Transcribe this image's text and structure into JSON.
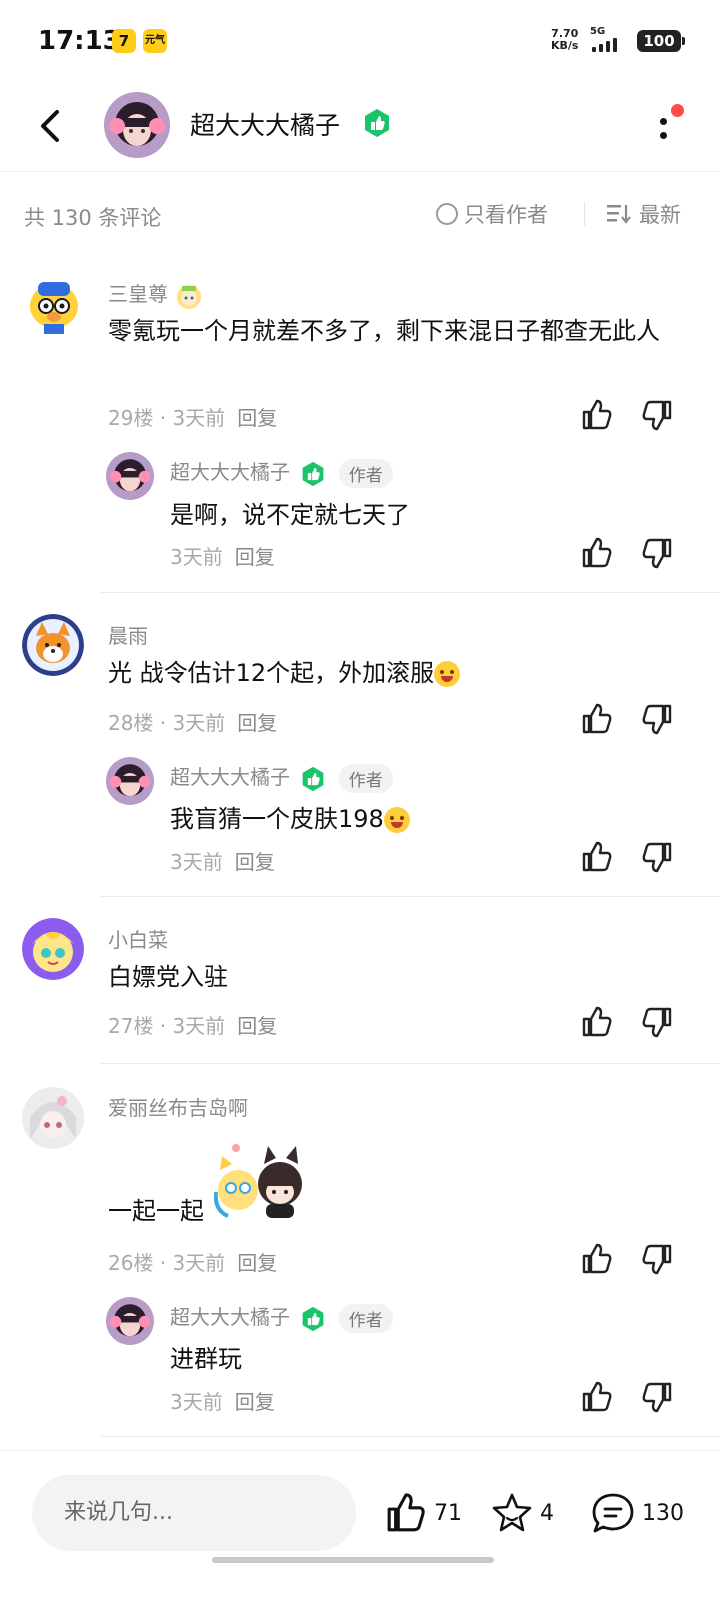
{
  "status_bar": {
    "time": "17:13",
    "app_icon_1": "7",
    "app_icon_2": "元气",
    "net_speed_value": "7.70",
    "net_speed_unit": "KB/s",
    "signal_label": "5G",
    "battery": "100"
  },
  "header": {
    "back_icon": "chevron-left-icon",
    "author_name": "超大大大橘子",
    "badge_icon": "verified-badge-icon",
    "more_icon": "more-vertical-icon",
    "notification_dot_color": "#ff4b4b"
  },
  "filter": {
    "count_label": "共 130 条评论",
    "only_author_label": "只看作者",
    "sort_label": "最新"
  },
  "comments": [
    {
      "user": "三皇尊",
      "text": "零氪玩一个月就差不多了，剩下来混日子都查无此人",
      "floor": "29楼",
      "time": "3天前",
      "reply_label": "回复",
      "reply": {
        "user": "超大大大橘子",
        "tag": "作者",
        "text": "是啊，说不定就七天了",
        "time": "3天前",
        "reply_label": "回复"
      }
    },
    {
      "user": "晨雨",
      "text": "光 战令估计12个起，外加滚服",
      "floor": "28楼",
      "time": "3天前",
      "reply_label": "回复",
      "reply": {
        "user": "超大大大橘子",
        "tag": "作者",
        "text": "我盲猜一个皮肤198",
        "time": "3天前",
        "reply_label": "回复"
      }
    },
    {
      "user": "小白菜",
      "text": "白嫖党入驻",
      "floor": "27楼",
      "time": "3天前",
      "reply_label": "回复"
    },
    {
      "user": "爱丽丝布吉岛啊",
      "text": "一起一起",
      "floor": "26楼",
      "time": "3天前",
      "reply_label": "回复",
      "reply": {
        "user": "超大大大橘子",
        "tag": "作者",
        "text": "进群玩",
        "time": "3天前",
        "reply_label": "回复"
      }
    }
  ],
  "bottom_bar": {
    "input_placeholder": "来说几句...",
    "like_count": "71",
    "favorite_count": "4",
    "comment_count": "130"
  },
  "colors": {
    "badge_green": "#19c46a",
    "muted_text": "#8a8a8a"
  }
}
